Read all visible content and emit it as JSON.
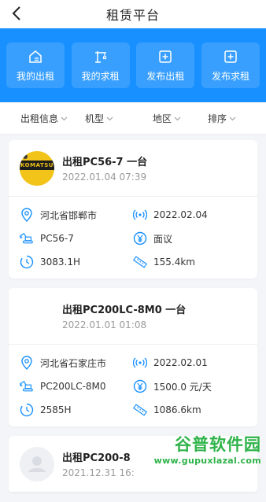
{
  "header": {
    "title": "租赁平台"
  },
  "quick_actions": [
    {
      "label": "我的出租",
      "icon": "house-icon"
    },
    {
      "label": "我的求租",
      "icon": "crane-icon"
    },
    {
      "label": "发布出租",
      "icon": "plus-box-icon"
    },
    {
      "label": "发布求租",
      "icon": "plus-box-icon"
    }
  ],
  "filters": [
    {
      "label": "出租信息"
    },
    {
      "label": "机型"
    },
    {
      "label": "地区"
    },
    {
      "label": "排序"
    }
  ],
  "colors": {
    "primary": "#1890ff",
    "accent": "#1890ff"
  },
  "listings": [
    {
      "title": "出租PC56-7 一台",
      "date": "2022.01.04 07:39",
      "avatar": "komatsu",
      "avatar_text": "KOMATSU",
      "location": "河北省邯郸市",
      "post_date": "2022.02.04",
      "model": "PC56-7",
      "price": "面议",
      "hours": "3083.1H",
      "distance": "155.4km"
    },
    {
      "title": "出租PC200LC-8M0 一台",
      "date": "2022.01.01 01:08",
      "avatar": "blank",
      "location": "河北省石家庄市",
      "post_date": "2022.02.01",
      "model": "PC200LC-8M0",
      "price": "1500.0 元/天",
      "hours": "2585H",
      "distance": "1086.6km"
    },
    {
      "title": "出租PC200-8",
      "date": "2021.12.31 16:",
      "avatar": "gray"
    }
  ],
  "watermark": {
    "main": "谷普软件园",
    "url": "www.gupuxlazal.com"
  }
}
